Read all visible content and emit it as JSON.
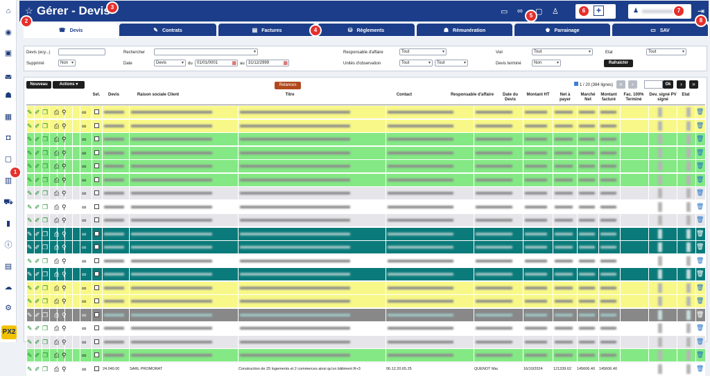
{
  "header": {
    "title": "Gérer - Devis"
  },
  "sidebar": {
    "icons": [
      "home-icon",
      "eye-icon",
      "briefcase-icon",
      "car-icon",
      "people-icon",
      "calendar-icon",
      "truck-icon",
      "calendar-check-icon",
      "building-icon",
      "cart-icon",
      "chart-icon",
      "info-icon",
      "save-icon",
      "cloud-upload-icon",
      "gear-icon"
    ],
    "logo": "PX2"
  },
  "tabs": [
    {
      "label": "Devis",
      "icon": "☎",
      "active": true
    },
    {
      "label": "Contrats",
      "icon": "✎"
    },
    {
      "label": "Factures",
      "icon": "▤"
    },
    {
      "label": "Règlements",
      "icon": "⛁"
    },
    {
      "label": "Rémunération",
      "icon": "☗"
    },
    {
      "label": "Parrainage",
      "icon": "♚"
    },
    {
      "label": "SAV",
      "icon": "▭"
    }
  ],
  "badges": [
    "1",
    "2",
    "3",
    "4",
    "5",
    "6",
    "7",
    "8"
  ],
  "filters": {
    "devis_label": "Devis (ecy...)",
    "rechercher_label": "Rechercher",
    "responsable_label": "Responsable d'affaire",
    "responsable_value": "Tout",
    "voir_label": "Voir",
    "voir_value": "Tout",
    "etat_label": "Etat",
    "etat_value": "Tout",
    "supprime_label": "Supprimé",
    "supprime_value": "Non",
    "date_label": "Date",
    "date_type": "Devis",
    "du_label": "du",
    "date_from": "01/01/0001",
    "au_label": "au",
    "date_to": "31/12/2999",
    "unites_label": "Unités d'observation",
    "unites_value1": "Tout",
    "unites_value2": "Tout",
    "devis_termine_label": "Devis terminé",
    "devis_termine_value": "Non",
    "refresh_label": "Rafraîchir"
  },
  "toolbar": {
    "nouveau": "Nouveau",
    "actions": "Actions",
    "relances": "Relances"
  },
  "pager": {
    "info": "1 / 20 (384 lignes)",
    "ok": "Ok"
  },
  "columns": [
    "Sel.",
    "Devis",
    "Raison sociale Client",
    "Titre",
    "Contact",
    "Responsable d'affaire",
    "Date du Devis",
    "Montant HT",
    "Net à payer",
    "Marché Net",
    "Montant facturé",
    "Fac. 100% Terminé",
    "Dev. signé PV signé",
    "Etat"
  ],
  "rows": [
    {
      "color": "#f8f888"
    },
    {
      "color": "#f8f888"
    },
    {
      "color": "#84e984"
    },
    {
      "color": "#84e984"
    },
    {
      "color": "#84e984"
    },
    {
      "color": "#84e984"
    },
    {
      "color": "#e6e6ea"
    },
    {
      "color": "#ffffff"
    },
    {
      "color": "#e6e6ea"
    },
    {
      "color": "#0b7a7a"
    },
    {
      "color": "#0b7a7a"
    },
    {
      "color": "#ffffff"
    },
    {
      "color": "#0b7a7a"
    },
    {
      "color": "#f8f888"
    },
    {
      "color": "#f8f888"
    },
    {
      "color": "#888888"
    },
    {
      "color": "#ffffff"
    },
    {
      "color": "#e6e6ea"
    },
    {
      "color": "#84e984"
    },
    {
      "color": "#ffffff",
      "devis": "24.040.00",
      "client": "SARL PROMORAT",
      "titre": "Construction de 25 logements et 2 commerces ainsi qu'un bâtiment R+3",
      "contact": "06.12.20.65.25",
      "responsable": "QUÉNOT Maxime",
      "date": "16/10/2024",
      "montant_ht": "121339.62",
      "net_payer": "145606.40",
      "marche": "145606.40"
    }
  ]
}
